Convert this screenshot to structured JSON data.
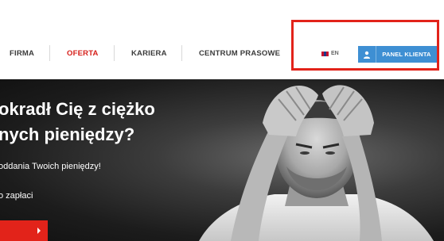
{
  "nav": {
    "items": [
      {
        "label": "FIRMA",
        "active": false
      },
      {
        "label": "OFERTA",
        "active": true
      },
      {
        "label": "KARIERA",
        "active": false
      },
      {
        "label": "CENTRUM PRASOWE",
        "active": false
      }
    ],
    "lang_label": "EN",
    "lang_icon": "uk-flag-icon",
    "panel_button_label": "PANEL KLIENTA",
    "panel_button_icon": "user-icon"
  },
  "hero": {
    "title_line1": "okradł Cię z ciężko",
    "title_line2": "nych pieniędzy?",
    "subtitle": "oddania Twoich pieniędzy!",
    "subtitle2": "o zapłaci",
    "cta_icon": "arrow-right-icon"
  },
  "colors": {
    "accent_red": "#e2231a",
    "panel_blue": "#3e8fd3",
    "nav_text": "#3b3b3b"
  }
}
